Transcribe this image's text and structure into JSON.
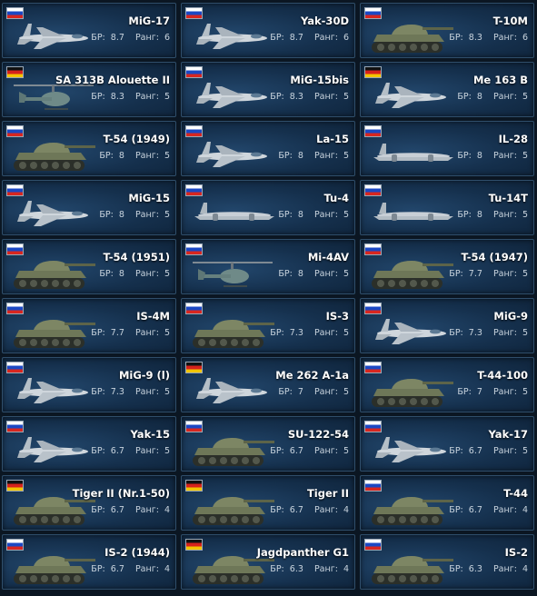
{
  "labels": {
    "br": "БР:",
    "rank": "Ранг:"
  },
  "vehicles": [
    {
      "name": "MiG-17",
      "br": "8.7",
      "rank": "6",
      "nation": "ussr-flag",
      "type": "jet"
    },
    {
      "name": "Yak-30D",
      "br": "8.7",
      "rank": "6",
      "nation": "ussr-flag",
      "type": "jet"
    },
    {
      "name": "T-10M",
      "br": "8.3",
      "rank": "6",
      "nation": "ussr-flag",
      "type": "tank"
    },
    {
      "name": "SA 313B Alouette II",
      "br": "8.3",
      "rank": "5",
      "nation": "germany-flag",
      "type": "heli"
    },
    {
      "name": "MiG-15bis",
      "br": "8.3",
      "rank": "5",
      "nation": "ussr-flag",
      "type": "jet"
    },
    {
      "name": "Me 163 B",
      "br": "8",
      "rank": "5",
      "nation": "germany-flag",
      "type": "jet"
    },
    {
      "name": "T-54 (1949)",
      "br": "8",
      "rank": "5",
      "nation": "ussr-flag",
      "type": "tank"
    },
    {
      "name": "La-15",
      "br": "8",
      "rank": "5",
      "nation": "ussr-flag",
      "type": "jet"
    },
    {
      "name": "IL-28",
      "br": "8",
      "rank": "5",
      "nation": "ussr-flag",
      "type": "bomber"
    },
    {
      "name": "MiG-15",
      "br": "8",
      "rank": "5",
      "nation": "ussr-flag",
      "type": "jet"
    },
    {
      "name": "Tu-4",
      "br": "8",
      "rank": "5",
      "nation": "ussr-flag",
      "type": "bomber"
    },
    {
      "name": "Tu-14T",
      "br": "8",
      "rank": "5",
      "nation": "ussr-flag",
      "type": "bomber"
    },
    {
      "name": "T-54 (1951)",
      "br": "8",
      "rank": "5",
      "nation": "ussr-flag",
      "type": "tank"
    },
    {
      "name": "Mi-4AV",
      "br": "8",
      "rank": "5",
      "nation": "ussr-flag",
      "type": "heli"
    },
    {
      "name": "T-54 (1947)",
      "br": "7.7",
      "rank": "5",
      "nation": "ussr-flag",
      "type": "tank"
    },
    {
      "name": "IS-4M",
      "br": "7.7",
      "rank": "5",
      "nation": "ussr-flag",
      "type": "tank"
    },
    {
      "name": "IS-3",
      "br": "7.3",
      "rank": "5",
      "nation": "ussr-flag",
      "type": "tank"
    },
    {
      "name": "MiG-9",
      "br": "7.3",
      "rank": "5",
      "nation": "ussr-flag",
      "type": "jet"
    },
    {
      "name": "MiG-9 (l)",
      "br": "7.3",
      "rank": "5",
      "nation": "ussr-flag",
      "type": "jet"
    },
    {
      "name": "Me 262 A-1a",
      "br": "7",
      "rank": "5",
      "nation": "germany-flag",
      "type": "jet"
    },
    {
      "name": "T-44-100",
      "br": "7",
      "rank": "5",
      "nation": "ussr-flag",
      "type": "tank"
    },
    {
      "name": "Yak-15",
      "br": "6.7",
      "rank": "5",
      "nation": "ussr-flag",
      "type": "jet"
    },
    {
      "name": "SU-122-54",
      "br": "6.7",
      "rank": "5",
      "nation": "ussr-flag",
      "type": "tank"
    },
    {
      "name": "Yak-17",
      "br": "6.7",
      "rank": "5",
      "nation": "ussr-flag",
      "type": "jet"
    },
    {
      "name": "Tiger II (Nr.1-50)",
      "br": "6.7",
      "rank": "4",
      "nation": "germany-flag",
      "type": "tank"
    },
    {
      "name": "Tiger II",
      "br": "6.7",
      "rank": "4",
      "nation": "germany-flag",
      "type": "tank"
    },
    {
      "name": "T-44",
      "br": "6.7",
      "rank": "4",
      "nation": "ussr-flag",
      "type": "tank"
    },
    {
      "name": "IS-2 (1944)",
      "br": "6.7",
      "rank": "4",
      "nation": "ussr-flag",
      "type": "tank"
    },
    {
      "name": "Jagdpanther G1",
      "br": "6.3",
      "rank": "4",
      "nation": "germany-flag",
      "type": "tank"
    },
    {
      "name": "IS-2",
      "br": "6.3",
      "rank": "4",
      "nation": "ussr-flag",
      "type": "tank"
    }
  ]
}
